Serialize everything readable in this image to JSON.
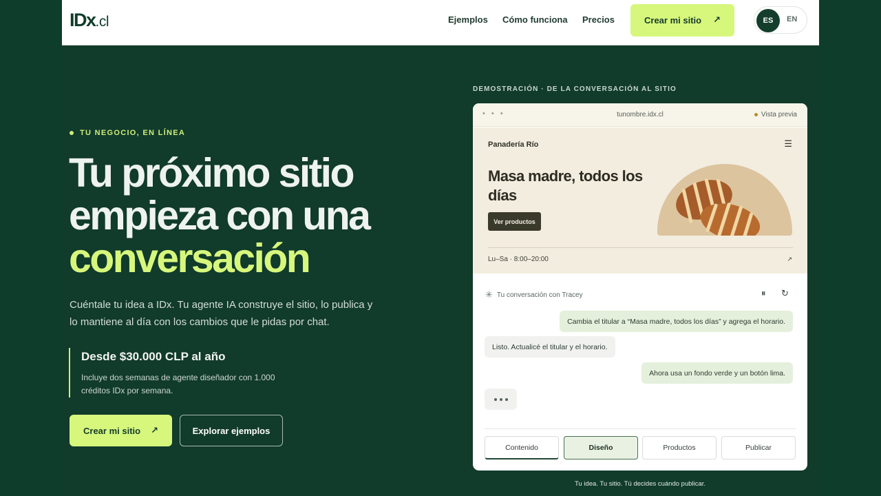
{
  "header": {
    "logo_main": "IDx",
    "logo_tld": ".cl",
    "nav": [
      "Ejemplos",
      "Cómo funciona",
      "Precios"
    ],
    "cta_label": "Crear mi sitio",
    "cta_arrow": "↗",
    "lang_active": "ES",
    "lang_other": "EN"
  },
  "hero": {
    "eyebrow": "TU NEGOCIO, EN LÍNEA",
    "headline_1": "Tu próximo sitio",
    "headline_2": "empieza con una",
    "headline_highlight": "conversación",
    "lead": "Cuéntale tu idea a IDx. Tu agente IA construye el sitio, lo publica y lo mantiene al día con los cambios que le pidas por chat.",
    "price_title": "Desde $30.000 CLP al año",
    "price_sub": "Incluye dos semanas de agente diseñador con 1.000 créditos IDx por semana.",
    "primary_button": "Crear mi sitio",
    "primary_arrow": "↗",
    "secondary_button": "Explorar ejemplos"
  },
  "demo": {
    "label": "DEMOSTRACIÓN · DE LA CONVERSACIÓN AL SITIO",
    "url": "tunombre.idx.cl",
    "preview_label": "Vista previa",
    "site": {
      "brand": "Panadería Río",
      "title": "Masa madre, todos los días",
      "button": "Ver productos",
      "hours": "Lu–Sa · 8:00–20:00",
      "hours_arrow": "↗"
    },
    "chat": {
      "title": "Tu conversación con Tracey",
      "messages": [
        {
          "role": "user",
          "text": "Cambia el titular a “Masa madre, todos los días” y agrega el horario."
        },
        {
          "role": "agent",
          "text": "Listo. Actualicé el titular y el horario."
        },
        {
          "role": "user",
          "text": "Ahora usa un fondo verde y un botón lima."
        }
      ]
    },
    "tabs": [
      "Contenido",
      "Diseño",
      "Productos",
      "Publicar"
    ],
    "selected_tab": "Diseño",
    "caption": "Tu idea. Tu sitio. Tú decides cuándo publicar."
  },
  "colors": {
    "page_bg": "#0f3d2c",
    "hero_bg": "#113b2b",
    "accent_lime": "#d6f77c",
    "header_bg": "#ffffff"
  }
}
